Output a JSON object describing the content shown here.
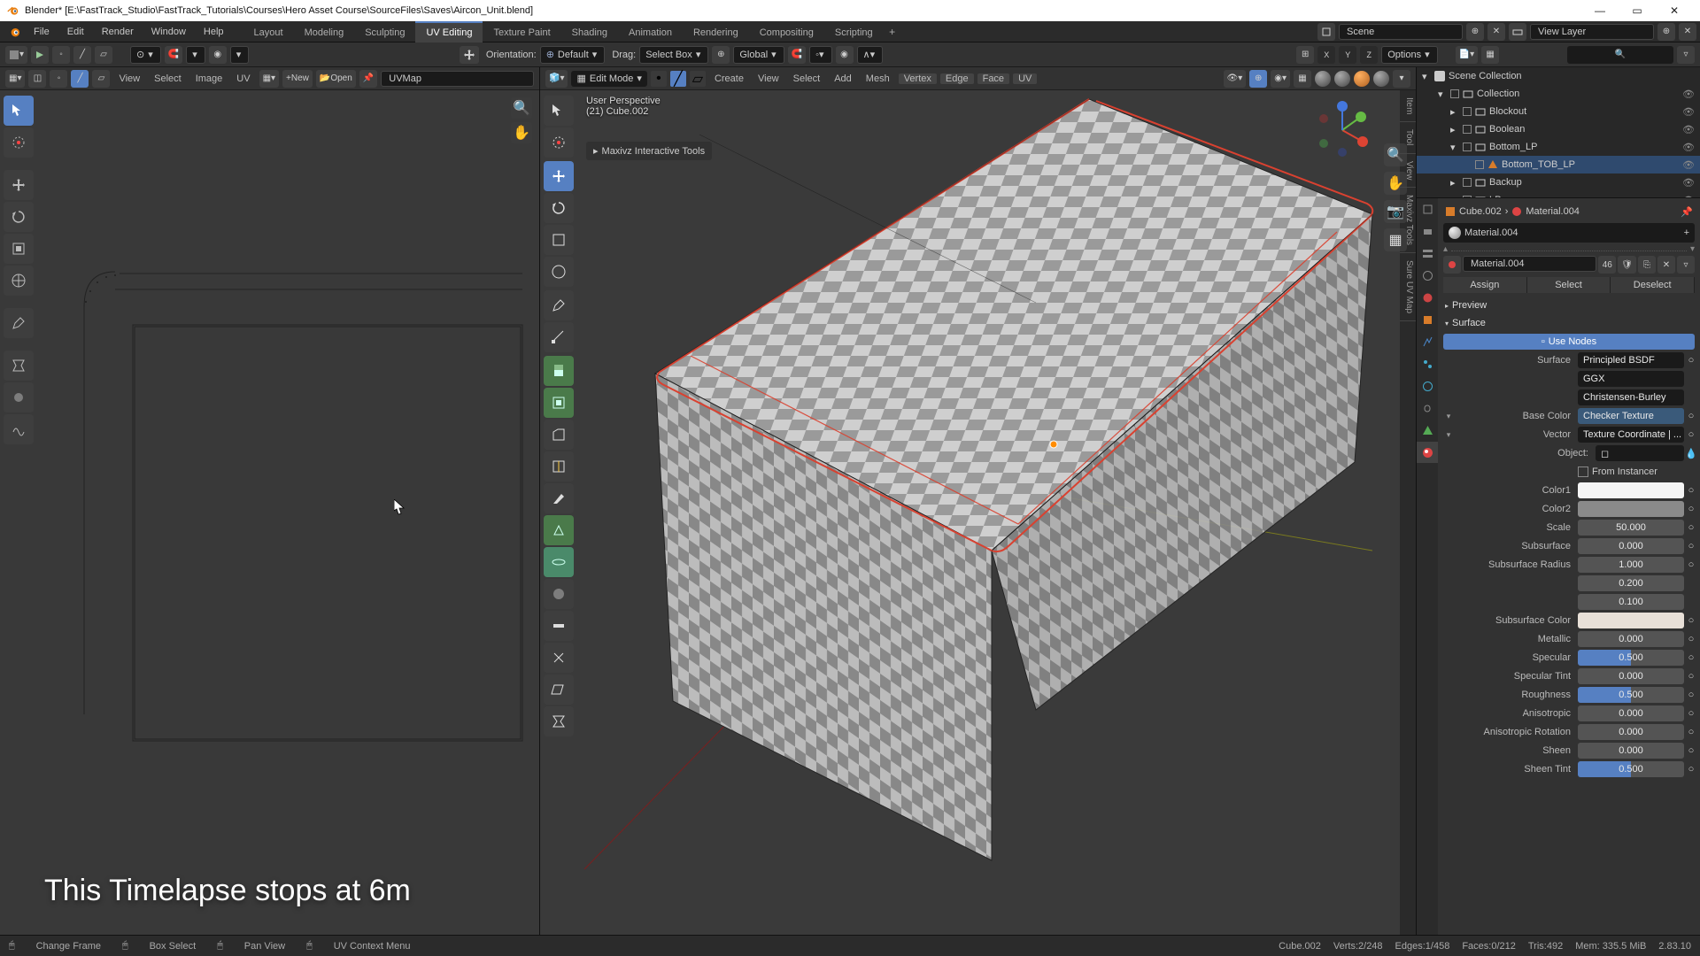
{
  "title": "Blender* [E:\\FastTrack_Studio\\FastTrack_Tutorials\\Courses\\Hero Asset Course\\SourceFiles\\Saves\\Aircon_Unit.blend]",
  "menubar": [
    "File",
    "Edit",
    "Render",
    "Window",
    "Help"
  ],
  "workspace_tabs": [
    "Layout",
    "Modeling",
    "Sculpting",
    "UV Editing",
    "Texture Paint",
    "Shading",
    "Animation",
    "Rendering",
    "Compositing",
    "Scripting"
  ],
  "workspace_active": "UV Editing",
  "scene": {
    "scene_label": "Scene",
    "viewlayer_label": "View Layer"
  },
  "toolbar": {
    "orientation_label": "Orientation:",
    "orientation_value": "Default",
    "drag_label": "Drag:",
    "drag_value": "Select Box",
    "global": "Global",
    "options": "Options"
  },
  "uv": {
    "menus": [
      "View",
      "Select",
      "Image",
      "UV"
    ],
    "new": "New",
    "open": "Open",
    "map": "UVMap"
  },
  "vp": {
    "mode": "Edit Mode",
    "menus": [
      "Add",
      "Mesh",
      "Vertex",
      "Edge",
      "Face",
      "UV"
    ],
    "view": "View",
    "select": "Select",
    "create": "Create",
    "persp": "User Perspective",
    "obj": "(21) Cube.002",
    "panel": "Maxivz Interactive Tools",
    "sidebar_tabs": [
      "Item",
      "Tool",
      "View",
      "Maxivz Tools",
      "Sure UV Map"
    ]
  },
  "outliner": {
    "title": "Scene Collection",
    "items": [
      {
        "name": "Collection",
        "indent": 1,
        "exp": true
      },
      {
        "name": "Blockout",
        "indent": 2
      },
      {
        "name": "Boolean",
        "indent": 2
      },
      {
        "name": "Bottom_LP",
        "indent": 2,
        "exp": true
      },
      {
        "name": "Bottom_TOB_LP",
        "indent": 3,
        "sel": true
      },
      {
        "name": "Backup",
        "indent": 2
      },
      {
        "name": "LP",
        "indent": 2
      }
    ]
  },
  "breadcrumb": {
    "obj": "Cube.002",
    "mat": "Material.004"
  },
  "material": {
    "slot": "Material.004",
    "field": "Material.004",
    "users": "46",
    "btn_assign": "Assign",
    "btn_select": "Select",
    "btn_deselect": "Deselect",
    "preview": "Preview",
    "surface": "Surface",
    "use_nodes": "Use Nodes"
  },
  "surface": {
    "surface_label": "Surface",
    "surface_val": "Principled BSDF",
    "dist": "GGX",
    "sss": "Christensen-Burley",
    "basecolor_label": "Base Color",
    "basecolor_val": "Checker Texture",
    "vector_label": "Vector",
    "vector_val": "Texture Coordinate | ...",
    "object_label": "Object:",
    "from_instancer": "From Instancer",
    "color1": "Color1",
    "color2": "Color2",
    "scale": "Scale",
    "scale_val": "50.000",
    "subsurface": "Subsurface",
    "subsurface_val": "0.000",
    "subsurface_radius": "Subsurface Radius",
    "ssr1": "1.000",
    "ssr2": "0.200",
    "ssr3": "0.100",
    "subsurface_color": "Subsurface Color",
    "metallic": "Metallic",
    "metallic_val": "0.000",
    "specular": "Specular",
    "specular_val": "0.500",
    "specular_tint": "Specular Tint",
    "specular_tint_val": "0.000",
    "roughness": "Roughness",
    "roughness_val": "0.500",
    "anisotropic": "Anisotropic",
    "anisotropic_val": "0.000",
    "aniso_rot": "Anisotropic Rotation",
    "aniso_rot_val": "0.000",
    "sheen": "Sheen",
    "sheen_val": "0.000",
    "sheen_tint": "Sheen Tint",
    "sheen_tint_val": "0.500"
  },
  "overlay_text": "This Timelapse stops at 6m",
  "status": {
    "change": "Change Frame",
    "box": "Box Select",
    "pan": "Pan View",
    "ctx": "UV Context Menu",
    "obj": "Cube.002",
    "verts": "Verts:2/248",
    "edges": "Edges:1/458",
    "faces": "Faces:0/212",
    "tris": "Tris:492",
    "mem": "Mem: 335.5 MiB",
    "ver": "2.83.10"
  }
}
